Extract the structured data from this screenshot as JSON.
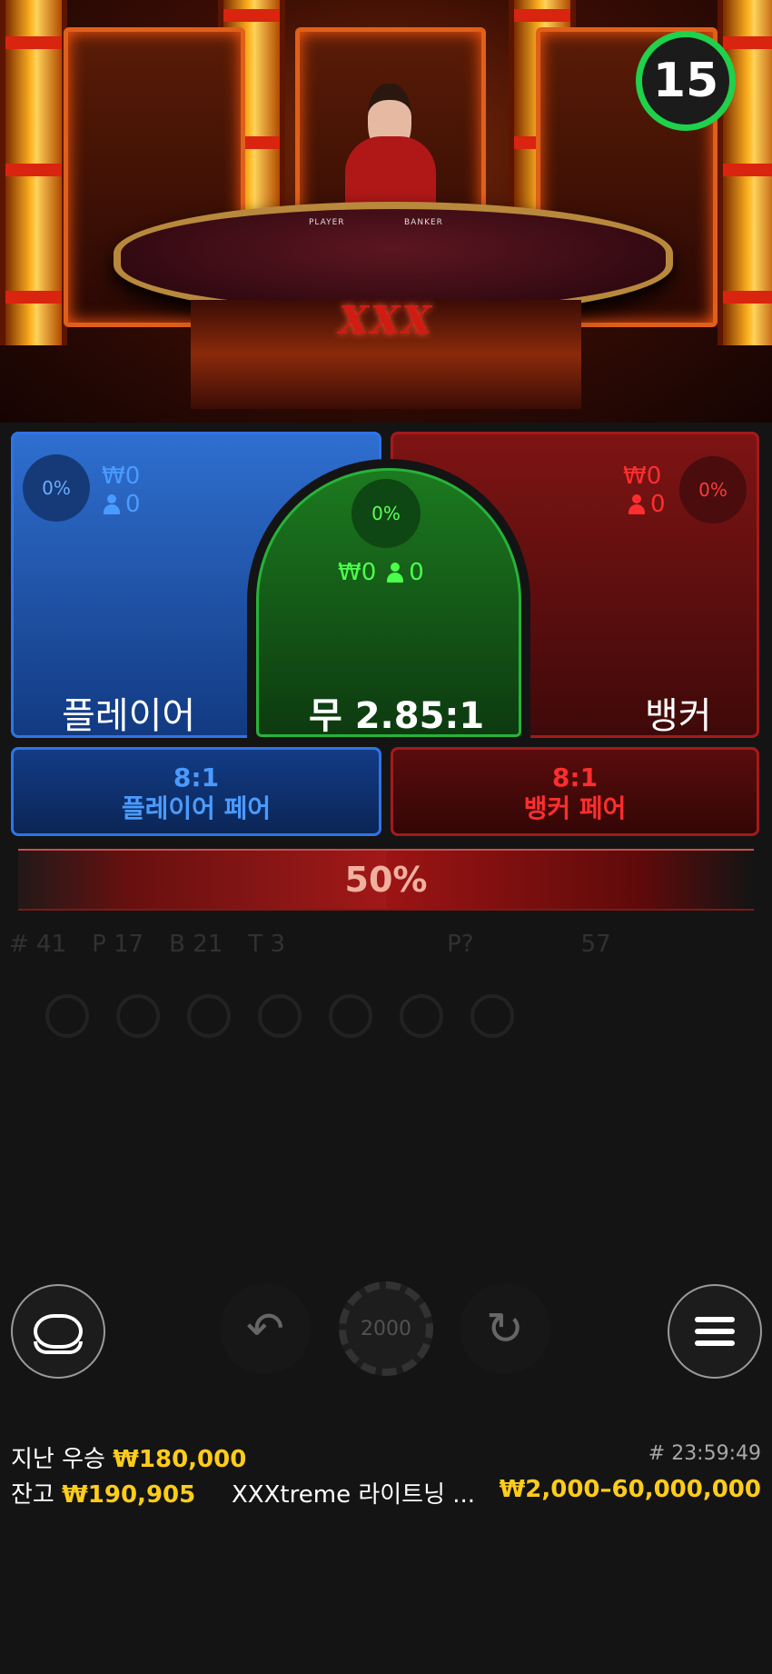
{
  "timer": {
    "seconds": "15"
  },
  "stage": {
    "table_logo": "XXX",
    "player_card_label": "PLAYER",
    "banker_card_label": "BANKER"
  },
  "bets": {
    "player": {
      "percent": "0%",
      "amount": "₩0",
      "players": "0",
      "label": "플레이어"
    },
    "tie": {
      "percent": "0%",
      "amount": "₩0",
      "players": "0",
      "label": "무 2.85:1"
    },
    "banker": {
      "percent": "0%",
      "amount": "₩0",
      "players": "0",
      "label": "뱅커"
    },
    "player_pair": {
      "odds": "8:1",
      "label": "플레이어 페어"
    },
    "banker_pair": {
      "odds": "8:1",
      "label": "뱅커 페어"
    }
  },
  "progress": {
    "text": "50%",
    "value": 0.5
  },
  "roadmap": {
    "total": "# 41",
    "player": "P 17",
    "banker": "B 21",
    "tie": "T 3",
    "p_label": "P?",
    "count": "57"
  },
  "controls": {
    "chip_value": "2000",
    "lobby_icon": "lobby-icon",
    "undo_icon": "undo-icon",
    "redo_icon": "redo-icon",
    "menu_icon": "menu-icon"
  },
  "footer": {
    "last_win_label": "지난 우승",
    "last_win_value": "₩180,000",
    "round_id": "# 23:59:49",
    "balance_label": "잔고",
    "balance_value": "₩190,905",
    "game_name": "XXXtreme 라이트닝 ...",
    "bet_limits": "₩2,000–60,000,000"
  },
  "colors": {
    "player": "#2f74e6",
    "banker": "#a51a1a",
    "tie": "#26b33a",
    "timer": "#1fd14b",
    "gold": "#ffcc1a"
  }
}
